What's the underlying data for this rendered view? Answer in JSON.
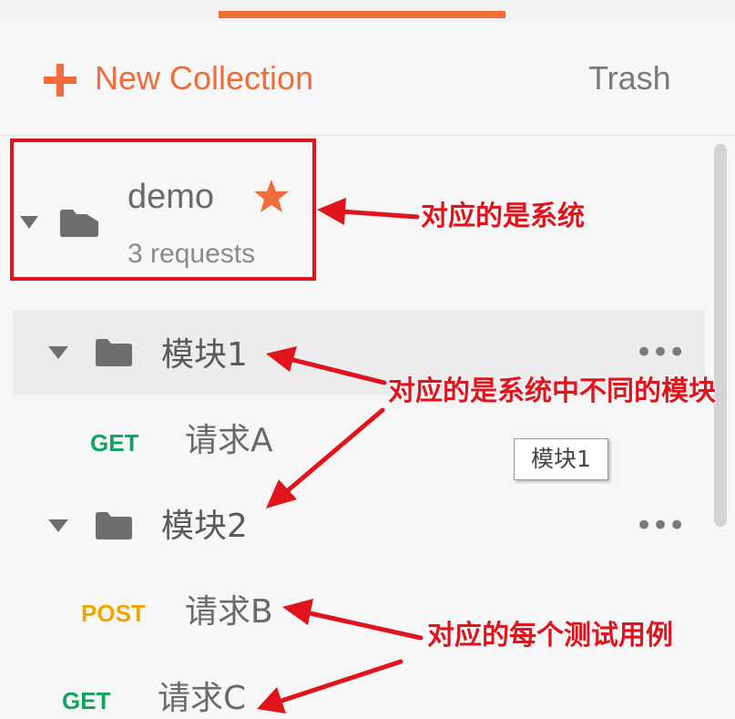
{
  "header": {
    "new_collection_label": "New Collection",
    "trash_label": "Trash"
  },
  "collection": {
    "name": "demo",
    "request_count": "3 requests",
    "starred": true
  },
  "folders": [
    {
      "name": "模块1",
      "requests": [
        {
          "method": "GET",
          "name": "请求A"
        }
      ]
    },
    {
      "name": "模块2",
      "requests": [
        {
          "method": "POST",
          "name": "请求B"
        },
        {
          "method": "GET",
          "name": "请求C"
        }
      ]
    }
  ],
  "tooltip": "模块1",
  "annotations": {
    "system": "对应的是系统",
    "module": "对应的是系统中不同的模块",
    "testcase": "对应的每个测试用例"
  },
  "colors": {
    "accent": "#f26b3a",
    "annotation": "#e0141c",
    "get": "#0fa35f",
    "post": "#f0a500"
  },
  "icons": {
    "add": "plus-icon",
    "favorite": "star-icon",
    "folder": "folder-icon",
    "expand": "caret-down-icon",
    "more": "more-dots-icon"
  }
}
